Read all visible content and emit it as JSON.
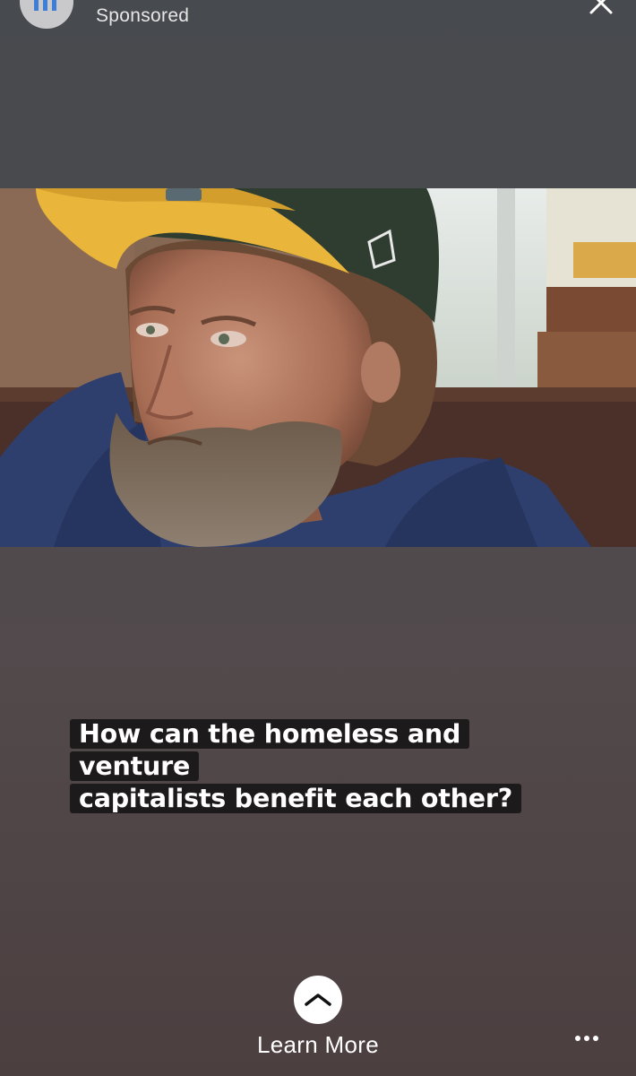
{
  "ad": {
    "sponsored_label": "Sponsored"
  },
  "caption": {
    "line1": "How can the homeless and venture",
    "line2": "capitalists benefit each other?"
  },
  "cta": {
    "label": "Learn More"
  },
  "icons": {
    "close": "close-icon",
    "chevron": "chevron-up-icon",
    "more": "more-options-icon"
  },
  "colors": {
    "caption_bg": "#1d1a1b",
    "cap_brim": "#e9b53a",
    "cap_crown": "#2f3d30",
    "hoodie": "#2e3f6e"
  }
}
